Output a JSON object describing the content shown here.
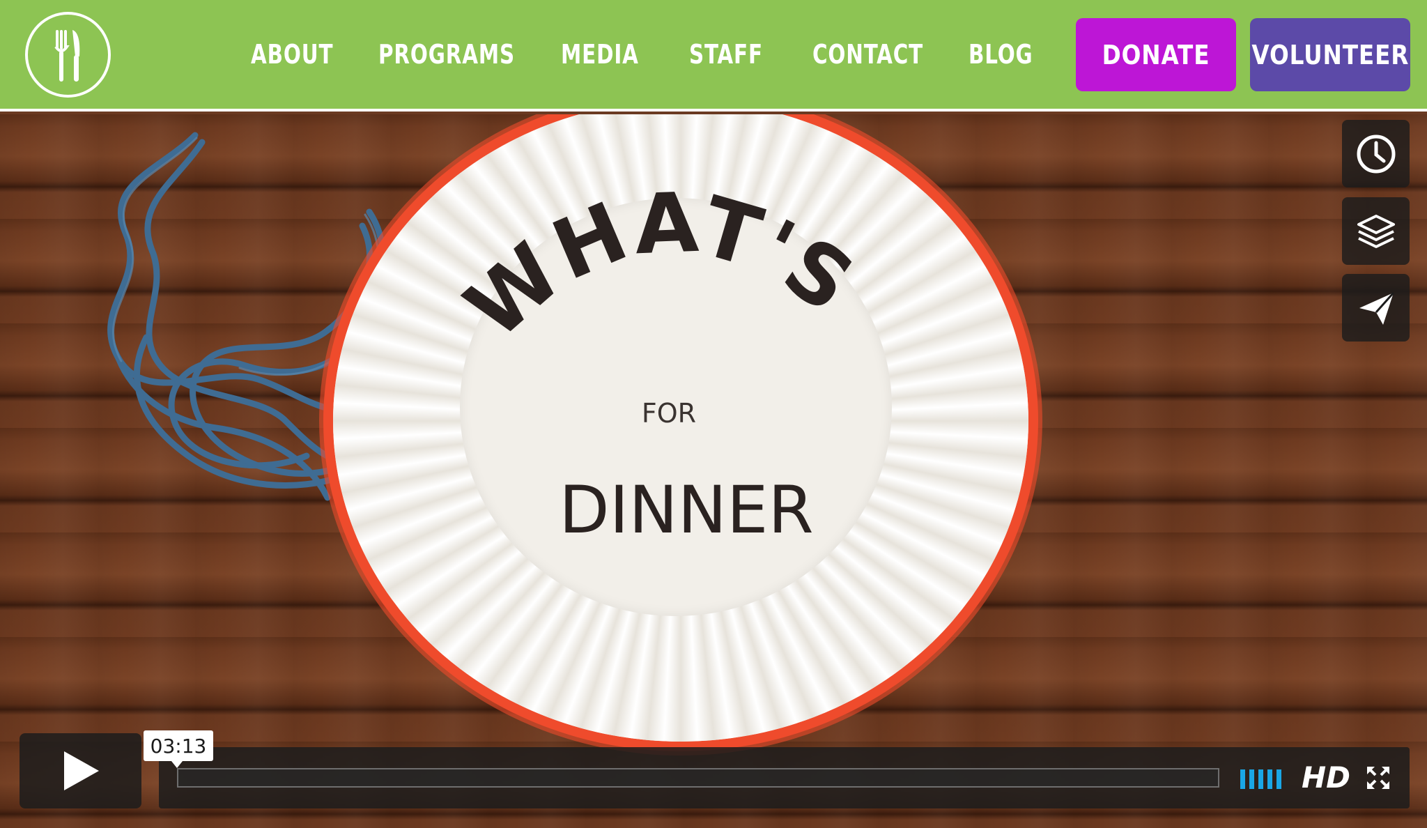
{
  "header": {
    "logo_icon": "fork-knife-icon",
    "nav": [
      {
        "label": "ABOUT"
      },
      {
        "label": "PROGRAMS"
      },
      {
        "label": "MEDIA"
      },
      {
        "label": "STAFF"
      },
      {
        "label": "CONTACT"
      },
      {
        "label": "BLOG"
      }
    ],
    "donate_label": "DONATE",
    "volunteer_label": "VOLUNTEER"
  },
  "video": {
    "plate_text": {
      "line1": "WHAT'S",
      "line2": "FOR",
      "line3": "DINNER"
    },
    "side_actions": [
      {
        "icon": "clock-icon"
      },
      {
        "icon": "layers-icon"
      },
      {
        "icon": "paper-plane-icon"
      }
    ],
    "controls": {
      "play_icon": "play-icon",
      "time": "03:13",
      "volume_icon": "volume-bars-icon",
      "hd_label": "HD",
      "fullscreen_icon": "fullscreen-icon"
    }
  },
  "colors": {
    "header_bg": "#8dc453",
    "donate_bg": "#bd16d6",
    "volunteer_bg": "#5c4aa8",
    "plate_rim": "#ef4b2c",
    "volume_accent": "#1aa7e6"
  }
}
